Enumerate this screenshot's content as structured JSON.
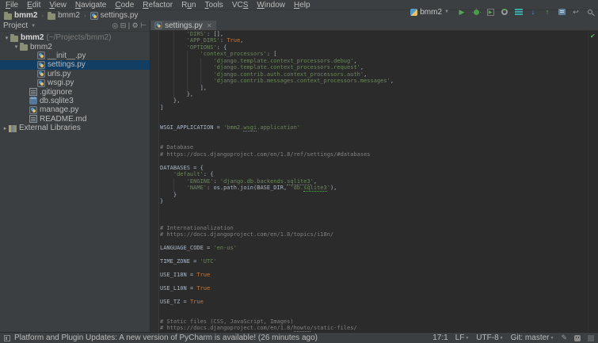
{
  "colors": {
    "panel_bg": "#3C3F41",
    "editor_bg": "#2B2B2B",
    "selection_blue": "#123E63",
    "string_green": "#6A8759",
    "keyword_orange": "#CC7832",
    "comment_gray": "#808080",
    "plain_text": "#A9B7C6",
    "run_green": "#57A557",
    "vcs_blue": "#4A9BD5",
    "ok_green": "#5FAD65"
  },
  "menu_bar": {
    "items": [
      {
        "label": "File",
        "mnemonic": 0
      },
      {
        "label": "Edit",
        "mnemonic": 0
      },
      {
        "label": "View",
        "mnemonic": 0
      },
      {
        "label": "Navigate",
        "mnemonic": 0
      },
      {
        "label": "Code",
        "mnemonic": 0
      },
      {
        "label": "Refactor",
        "mnemonic": 0
      },
      {
        "label": "Run",
        "mnemonic": 1
      },
      {
        "label": "Tools",
        "mnemonic": 0
      },
      {
        "label": "VCS",
        "mnemonic": 2
      },
      {
        "label": "Window",
        "mnemonic": 0
      },
      {
        "label": "Help",
        "mnemonic": 0
      }
    ]
  },
  "nav_bar": {
    "crumbs": [
      {
        "label": "bmm2",
        "icon": "folder",
        "bold": true
      },
      {
        "label": "bmm2",
        "icon": "folder",
        "bold": false
      },
      {
        "label": "settings.py",
        "icon": "python",
        "bold": false
      }
    ]
  },
  "toolbar": {
    "run_config": "bmm2",
    "icons": [
      "run-icon",
      "debug-icon",
      "run-with-coverage-icon",
      "profiler-icon",
      "console-icon",
      "vcs-update-icon",
      "vcs-commit-icon",
      "vcs-dialog-icon",
      "undo-icon",
      "search-everywhere-icon"
    ]
  },
  "project_panel": {
    "title": "Project",
    "header_icons": [
      {
        "name": "scroll-from-source-icon",
        "glyph": "◎"
      },
      {
        "name": "collapse-all-icon",
        "glyph": "⊟"
      },
      {
        "name": "divider",
        "glyph": "|"
      },
      {
        "name": "settings-gear-icon",
        "glyph": "⚙"
      },
      {
        "name": "hide-panel-icon",
        "glyph": "⊢"
      }
    ],
    "tree": [
      {
        "label": "bmm2",
        "suffix": " (~/Projects/bmm2)",
        "icon": "folder",
        "arrow": "down",
        "indent": 4,
        "bold": true,
        "selected": false
      },
      {
        "label": "bmm2",
        "suffix": "",
        "icon": "folder",
        "arrow": "down",
        "indent": 16,
        "bold": false,
        "selected": false
      },
      {
        "label": "__init__.py",
        "suffix": "",
        "icon": "python",
        "arrow": null,
        "indent": 38,
        "bold": false,
        "selected": false
      },
      {
        "label": "settings.py",
        "suffix": "",
        "icon": "python",
        "arrow": null,
        "indent": 38,
        "bold": false,
        "selected": true
      },
      {
        "label": "urls.py",
        "suffix": "",
        "icon": "python",
        "arrow": null,
        "indent": 38,
        "bold": false,
        "selected": false
      },
      {
        "label": "wsgi.py",
        "suffix": "",
        "icon": "python",
        "arrow": null,
        "indent": 38,
        "bold": false,
        "selected": false
      },
      {
        "label": ".gitignore",
        "suffix": "",
        "icon": "text",
        "arrow": null,
        "indent": 28,
        "bold": false,
        "selected": false
      },
      {
        "label": "db.sqlite3",
        "suffix": "",
        "icon": "db",
        "arrow": null,
        "indent": 28,
        "bold": false,
        "selected": false
      },
      {
        "label": "manage.py",
        "suffix": "",
        "icon": "python",
        "arrow": null,
        "indent": 28,
        "bold": false,
        "selected": false
      },
      {
        "label": "README.md",
        "suffix": "",
        "icon": "text",
        "arrow": null,
        "indent": 28,
        "bold": false,
        "selected": false
      },
      {
        "label": "External Libraries",
        "suffix": "",
        "icon": "lib",
        "arrow": "right",
        "indent": 2,
        "bold": false,
        "selected": false
      }
    ]
  },
  "editor": {
    "tab": {
      "label": "settings.py",
      "close_glyph": "✕",
      "icon": "python"
    },
    "inspection_status": "ok",
    "code_lines": [
      [
        [
          "p",
          "        "
        ],
        [
          "s",
          "'DIRS'"
        ],
        [
          "p",
          ": [],"
        ]
      ],
      [
        [
          "p",
          "        "
        ],
        [
          "s",
          "'APP_DIRS'"
        ],
        [
          "p",
          ": "
        ],
        [
          "k",
          "True"
        ],
        [
          "p",
          ","
        ]
      ],
      [
        [
          "p",
          "        "
        ],
        [
          "s",
          "'OPTIONS'"
        ],
        [
          "p",
          ": {"
        ]
      ],
      [
        [
          "p",
          "            "
        ],
        [
          "s",
          "'context_processors'"
        ],
        [
          "p",
          ": ["
        ]
      ],
      [
        [
          "p",
          "                "
        ],
        [
          "s",
          "'django.template.context_processors.debug'"
        ],
        [
          "p",
          ","
        ]
      ],
      [
        [
          "p",
          "                "
        ],
        [
          "s",
          "'django.template.context_processors.request'"
        ],
        [
          "p",
          ","
        ]
      ],
      [
        [
          "p",
          "                "
        ],
        [
          "s",
          "'django.contrib.auth.context_processors.auth'"
        ],
        [
          "p",
          ","
        ]
      ],
      [
        [
          "p",
          "                "
        ],
        [
          "s",
          "'django.contrib.messages.context_processors.messages'"
        ],
        [
          "p",
          ","
        ]
      ],
      [
        [
          "p",
          "            ],"
        ]
      ],
      [
        [
          "p",
          "        },"
        ]
      ],
      [
        [
          "p",
          "    },"
        ]
      ],
      [
        [
          "p",
          "]"
        ]
      ],
      [],
      [],
      [
        [
          "p",
          "WSGI_APPLICATION = "
        ],
        [
          "s",
          "'bmm2."
        ],
        [
          "su",
          "wsgi"
        ],
        [
          "s",
          ".application'"
        ]
      ],
      [],
      [],
      [
        [
          "c",
          "# Database"
        ]
      ],
      [
        [
          "c",
          "# https://docs.djangoproject.com/en/1.8/ref/settings/#databases"
        ]
      ],
      [],
      [
        [
          "p",
          "DATABASES = {"
        ]
      ],
      [
        [
          "p",
          "    "
        ],
        [
          "s",
          "'default'"
        ],
        [
          "p",
          ": {"
        ]
      ],
      [
        [
          "p",
          "        "
        ],
        [
          "s",
          "'ENGINE'"
        ],
        [
          "p",
          ": "
        ],
        [
          "s",
          "'django.db.backends."
        ],
        [
          "su",
          "sqlite3"
        ],
        [
          "s",
          "'"
        ],
        [
          "p",
          ","
        ]
      ],
      [
        [
          "p",
          "        "
        ],
        [
          "s",
          "'NAME'"
        ],
        [
          "p",
          ": os.path.join(BASE_DIR, "
        ],
        [
          "s",
          "'db."
        ],
        [
          "su",
          "sqlite3"
        ],
        [
          "s",
          "'"
        ],
        [
          "p",
          "),"
        ]
      ],
      [
        [
          "p",
          "    }"
        ]
      ],
      [
        [
          "p",
          "}"
        ]
      ],
      [],
      [],
      [],
      [
        [
          "c",
          "# Internationalization"
        ]
      ],
      [
        [
          "c",
          "# https://docs.djangoproject.com/en/1.8/topics/i18n/"
        ]
      ],
      [],
      [
        [
          "p",
          "LANGUAGE_CODE = "
        ],
        [
          "s",
          "'en-us'"
        ]
      ],
      [],
      [
        [
          "p",
          "TIME_ZONE = "
        ],
        [
          "s",
          "'UTC'"
        ]
      ],
      [],
      [
        [
          "p",
          "USE_I18N = "
        ],
        [
          "k",
          "True"
        ]
      ],
      [],
      [
        [
          "p",
          "USE_L10N = "
        ],
        [
          "k",
          "True"
        ]
      ],
      [],
      [
        [
          "p",
          "USE_TZ = "
        ],
        [
          "k",
          "True"
        ]
      ],
      [],
      [],
      [
        [
          "c",
          "# Static files (CSS, JavaScript, Images)"
        ]
      ],
      [
        [
          "c",
          "# https://docs.djangoproject.com/en/1.8/"
        ],
        [
          "cu",
          "howto"
        ],
        [
          "c",
          "/static-files/"
        ]
      ]
    ],
    "indent_guides": [
      {
        "col": 4,
        "from": 1,
        "to": 10
      },
      {
        "col": 8,
        "from": 4,
        "to": 9
      },
      {
        "col": 12,
        "from": 5,
        "to": 8
      },
      {
        "col": 4,
        "from": 23,
        "to": 24
      }
    ]
  },
  "status_bar": {
    "message": "Platform and Plugin Updates: A new version of PyCharm is available! (26 minutes ago)",
    "position": "17:1",
    "line_separator": "LF",
    "encoding": "UTF-8",
    "vcs_branch": "Git: master"
  }
}
